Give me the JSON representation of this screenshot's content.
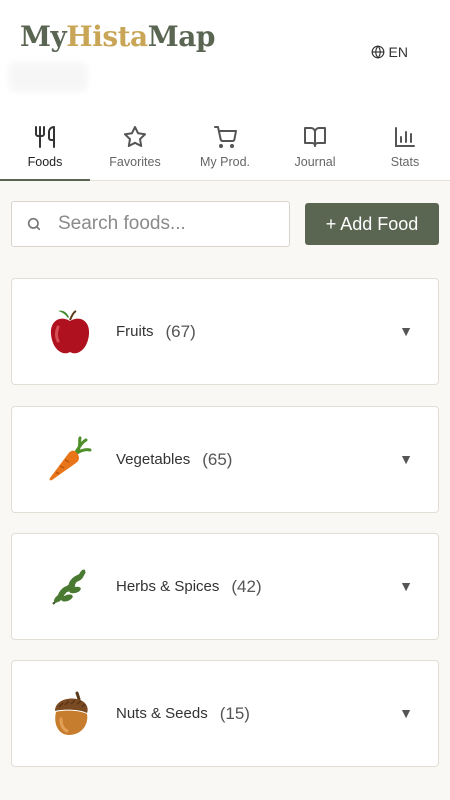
{
  "brand": {
    "part1": "My",
    "part2": "Hista",
    "part3": "Map"
  },
  "header": {
    "language": "EN"
  },
  "tabs": [
    {
      "label": "Foods",
      "icon": "fork-knife-icon",
      "active": true
    },
    {
      "label": "Favorites",
      "icon": "star-icon",
      "active": false
    },
    {
      "label": "My Prod.",
      "icon": "cart-icon",
      "active": false
    },
    {
      "label": "Journal",
      "icon": "book-icon",
      "active": false
    },
    {
      "label": "Stats",
      "icon": "bar-chart-icon",
      "active": false
    }
  ],
  "search": {
    "placeholder": "Search foods..."
  },
  "actions": {
    "add_food": "+ Add Food"
  },
  "categories": [
    {
      "name": "Fruits",
      "count": "(67)",
      "icon": "apple-icon"
    },
    {
      "name": "Vegetables",
      "count": "(65)",
      "icon": "carrot-icon"
    },
    {
      "name": "Herbs & Spices",
      "count": "(42)",
      "icon": "herb-icon"
    },
    {
      "name": "Nuts & Seeds",
      "count": "(15)",
      "icon": "acorn-icon"
    }
  ],
  "colors": {
    "accent": "#5a6652",
    "brand_gold": "#c9a557",
    "background": "#faf8f4"
  }
}
